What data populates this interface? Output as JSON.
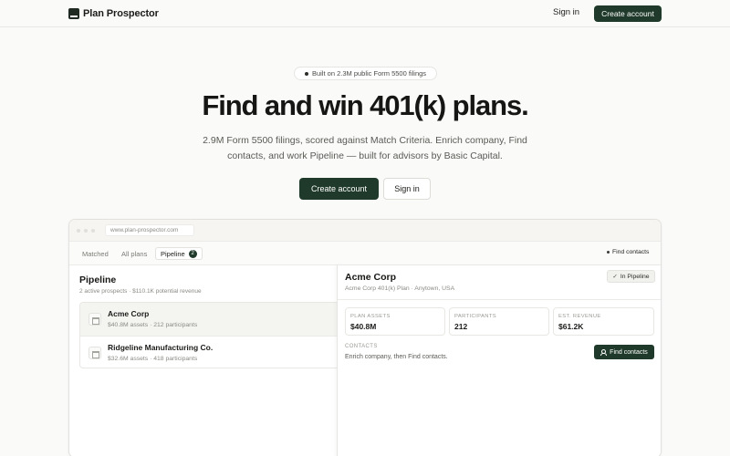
{
  "nav": {
    "brand": "Plan Prospector",
    "sign_in": "Sign in",
    "create_account": "Create account"
  },
  "hero": {
    "badge": "Built on 2.3M public Form 5500 filings",
    "title": "Find and win 401(k) plans.",
    "subtitle": "2.9M Form 5500 filings, scored against Match Criteria. Enrich company, Find contacts, and work Pipeline — built for advisors by Basic Capital.",
    "cta_primary": "Create account",
    "cta_secondary": "Sign in"
  },
  "app": {
    "url": "www.plan-prospector.com",
    "tabs": [
      {
        "label": "Matched"
      },
      {
        "label": "All plans"
      },
      {
        "label": "Pipeline",
        "count": "2"
      }
    ],
    "find_contacts_link": "Find contacts",
    "pipeline": {
      "title": "Pipeline",
      "summary": "2 active prospects · $110.1K potential revenue",
      "items": [
        {
          "name": "Acme Corp",
          "meta": "$40.8M assets · 212 participants"
        },
        {
          "name": "Ridgeline Manufacturing Co.",
          "meta": "$32.6M assets · 418 participants"
        }
      ]
    },
    "detail": {
      "name": "Acme Corp",
      "subtitle": "Acme Corp 401(k) Plan · Anytown, USA",
      "status": "In Pipeline",
      "stats": [
        {
          "label": "PLAN ASSETS",
          "value": "$40.8M"
        },
        {
          "label": "PARTICIPANTS",
          "value": "212"
        },
        {
          "label": "EST. REVENUE",
          "value": "$61.2K"
        }
      ],
      "contacts_label": "CONTACTS",
      "contacts_text": "Enrich company, then Find contacts.",
      "find_button": "Find contacts"
    }
  }
}
